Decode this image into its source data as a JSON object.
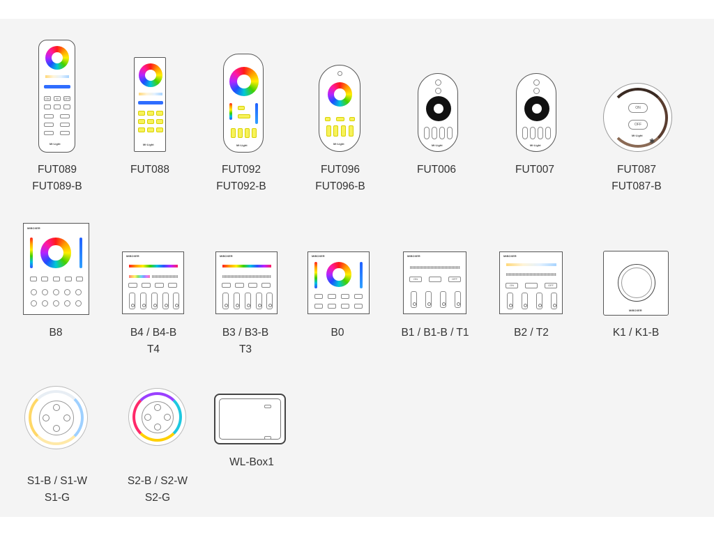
{
  "colors": {
    "background": "#f4f4f4",
    "label_text": "#333333",
    "outline": "#555555"
  },
  "row1": [
    {
      "id": "fut089",
      "lines": [
        "FUT089",
        "FUT089-B"
      ]
    },
    {
      "id": "fut088",
      "lines": [
        "FUT088"
      ]
    },
    {
      "id": "fut092",
      "lines": [
        "FUT092",
        "FUT092-B"
      ]
    },
    {
      "id": "fut096",
      "lines": [
        "FUT096",
        "FUT096-B"
      ]
    },
    {
      "id": "fut006",
      "lines": [
        "FUT006"
      ]
    },
    {
      "id": "fut007",
      "lines": [
        "FUT007"
      ]
    },
    {
      "id": "fut087",
      "lines": [
        "FUT087",
        "FUT087-B"
      ]
    }
  ],
  "row2": [
    {
      "id": "b8",
      "lines": [
        "B8"
      ]
    },
    {
      "id": "b4",
      "lines": [
        "B4 / B4-B",
        "T4"
      ]
    },
    {
      "id": "b3",
      "lines": [
        "B3 / B3-B",
        "T3"
      ]
    },
    {
      "id": "b0",
      "lines": [
        "B0"
      ]
    },
    {
      "id": "b1",
      "lines": [
        "B1 / B1-B / T1"
      ]
    },
    {
      "id": "b2",
      "lines": [
        "B2 / T2"
      ]
    },
    {
      "id": "k1",
      "lines": [
        "K1 / K1-B"
      ]
    }
  ],
  "row3": [
    {
      "id": "s1",
      "lines": [
        "S1-B / S1-W",
        "S1-G"
      ]
    },
    {
      "id": "s2",
      "lines": [
        "S2-B / S2-W",
        "S2-G"
      ]
    },
    {
      "id": "wlbox1",
      "lines": [
        "WL-Box1"
      ]
    }
  ],
  "device_text": {
    "brand_small": "Mi·Light",
    "brand_panel": "MiBOXER",
    "on": "ON",
    "off": "OFF",
    "w": "W"
  },
  "icons": {
    "remote": "remote-control-icon",
    "panel": "wall-panel-icon",
    "knob": "rotary-knob-icon",
    "box": "wifi-box-icon"
  }
}
